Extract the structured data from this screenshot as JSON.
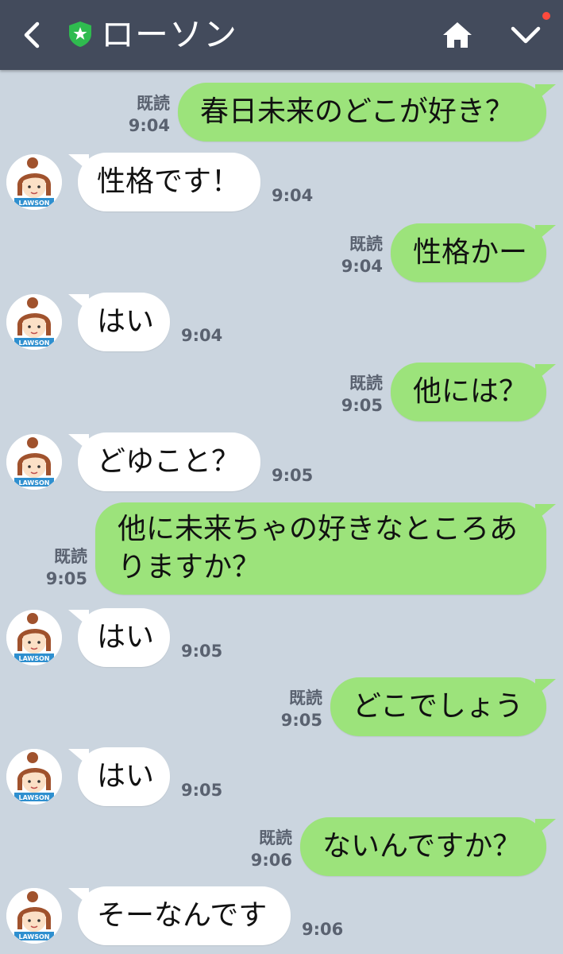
{
  "header": {
    "title": "ローソン",
    "back_icon": "chevron-left-icon",
    "badge_icon": "shield-star-icon",
    "home_icon": "home-icon",
    "menu_icon": "chevron-down-icon",
    "colors": {
      "bar": "#434b5c",
      "badge": "#2fbb4f",
      "notify": "#ff4a3d"
    }
  },
  "contact": {
    "avatar_text": "LAWSON"
  },
  "colors": {
    "background": "#cbd5df",
    "outgoing": "#9ce37b",
    "incoming": "#ffffff"
  },
  "messages": [
    {
      "side": "out",
      "text": "春日未来のどこが好き？",
      "read": "既読",
      "time": "9:04"
    },
    {
      "side": "in",
      "text": "性格です！",
      "time": "9:04"
    },
    {
      "side": "out",
      "text": "性格かー",
      "read": "既読",
      "time": "9:04"
    },
    {
      "side": "in",
      "text": "はい",
      "time": "9:04"
    },
    {
      "side": "out",
      "text": "他には？",
      "read": "既読",
      "time": "9:05"
    },
    {
      "side": "in",
      "text": "どゆこと？",
      "time": "9:05"
    },
    {
      "side": "out",
      "text": "他に未来ちゃの好きなところありますか？",
      "read": "既読",
      "time": "9:05"
    },
    {
      "side": "in",
      "text": "はい",
      "time": "9:05"
    },
    {
      "side": "out",
      "text": "どこでしょう",
      "read": "既読",
      "time": "9:05"
    },
    {
      "side": "in",
      "text": "はい",
      "time": "9:05"
    },
    {
      "side": "out",
      "text": "ないんですか？",
      "read": "既読",
      "time": "9:06"
    },
    {
      "side": "in",
      "text": "そーなんです",
      "time": "9:06"
    }
  ]
}
